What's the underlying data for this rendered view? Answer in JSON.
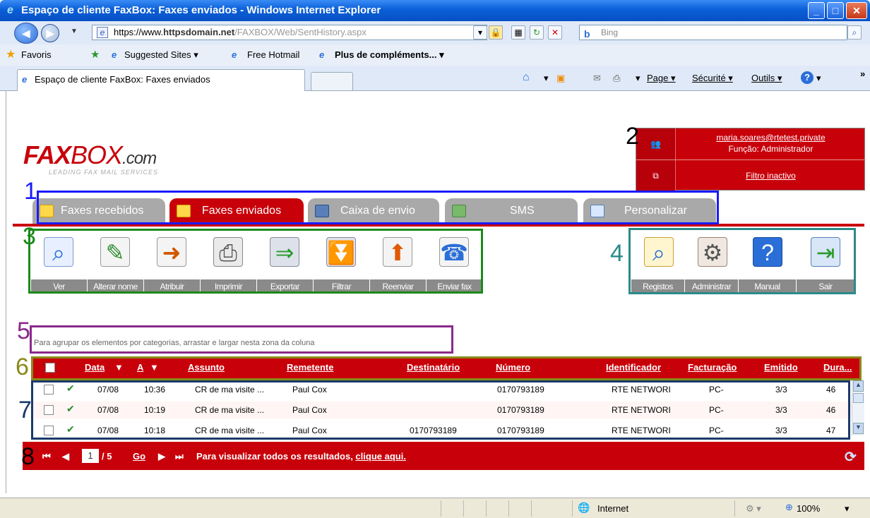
{
  "browser": {
    "title": "Espaço de cliente FaxBox: Faxes enviados - Windows Internet Explorer",
    "url_prefix": "https://www.",
    "url_domain": "httpsdomain.net",
    "url_path": "/FAXBOX/Web/SentHistory.aspx",
    "search_placeholder": "Bing",
    "favorites": {
      "favoris": "Favoris",
      "suggested": "Suggested Sites ▾",
      "hotmail": "Free Hotmail",
      "more": "Plus de compléments... ▾"
    },
    "tab_title": "Espaço de cliente FaxBox: Faxes enviados",
    "commands": {
      "page": "Page ▾",
      "security": "Sécurité ▾",
      "tools": "Outils ▾"
    },
    "status": {
      "zone": "Internet",
      "zoom": "100%"
    }
  },
  "logo": {
    "fax": "FAX",
    "box": "BOX",
    "com": ".com",
    "tagline": "LEADING FAX MAIL SERVICES"
  },
  "user": {
    "email": "maria.soares@rtetest.private",
    "role": "Função: Administrador",
    "filter": "Filtro inactivo"
  },
  "nav_tabs": [
    {
      "label": "Faxes recebidos",
      "active": false
    },
    {
      "label": "Faxes enviados",
      "active": true
    },
    {
      "label": "Caixa de envio",
      "active": false
    },
    {
      "label": "SMS",
      "active": false
    },
    {
      "label": "Personalizar",
      "active": false
    }
  ],
  "toolbar_left": [
    {
      "label": "Ver",
      "icon": "view-icon"
    },
    {
      "label": "Alterar nome",
      "icon": "rename-icon"
    },
    {
      "label": "Atribuir",
      "icon": "assign-icon"
    },
    {
      "label": "Imprimir",
      "icon": "print-icon"
    },
    {
      "label": "Exportar",
      "icon": "export-icon"
    },
    {
      "label": "Filtrar",
      "icon": "filter-icon"
    },
    {
      "label": "Reenviar",
      "icon": "resend-icon"
    },
    {
      "label": "Enviar fax",
      "icon": "send-fax-icon"
    }
  ],
  "toolbar_right": [
    {
      "label": "Registos",
      "icon": "logs-icon"
    },
    {
      "label": "Administrar",
      "icon": "admin-icon"
    },
    {
      "label": "Manual",
      "icon": "manual-icon"
    },
    {
      "label": "Sair",
      "icon": "exit-icon"
    }
  ],
  "group_hint": "Para agrupar os elementos por categorias, arrastar e largar nesta zona da coluna",
  "grid": {
    "columns": [
      "Data",
      "A",
      "Assunto",
      "Remetente",
      "Destinatário",
      "Número",
      "Identificador",
      "Facturação",
      "Emitido",
      "Dura..."
    ],
    "rows": [
      [
        "07/08",
        "10:36",
        "CR de ma visite ...",
        "Paul Cox",
        "",
        "0170793189",
        "RTE NETWORI",
        "PC-",
        "3/3",
        "46"
      ],
      [
        "07/08",
        "10:19",
        "CR de ma visite ...",
        "Paul Cox",
        "",
        "0170793189",
        "RTE NETWORI",
        "PC-",
        "3/3",
        "46"
      ],
      [
        "07/08",
        "10:18",
        "CR de ma visite ...",
        "Paul Cox",
        "0170793189",
        "0170793189",
        "RTE NETWORI",
        "PC-",
        "3/3",
        "47"
      ]
    ]
  },
  "pager": {
    "current": "1",
    "total": "/ 5",
    "go": "Go",
    "text": "Para visualizar todos os resultados, ",
    "link": "clique aqui."
  },
  "annotations": [
    "1",
    "2",
    "3",
    "4",
    "5",
    "6",
    "7",
    "8"
  ],
  "colors": {
    "brand_red": "#c8000a",
    "ann_blue": "#1a1aff",
    "ann_green": "#1a8a1a",
    "ann_teal": "#2a8a8a",
    "ann_purple": "#8a2a8a",
    "ann_olive": "#8a8a1a",
    "ann_navy": "#1a3a6a"
  }
}
